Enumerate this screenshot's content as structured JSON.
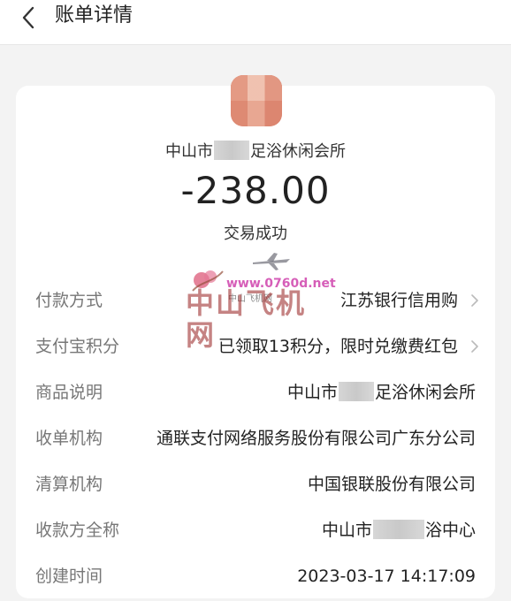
{
  "header": {
    "title": "账单详情"
  },
  "summary": {
    "merchant_prefix": "中山市",
    "merchant_suffix": "足浴休闲会所",
    "amount": "-238.00",
    "status": "交易成功"
  },
  "rows": [
    {
      "label": "付款方式",
      "value": "江苏银行信用购"
    },
    {
      "label": "支付宝积分",
      "value": "已领取13积分，限时兑缴费红包"
    },
    {
      "label": "商品说明",
      "value_prefix": "中山市",
      "value_suffix": "足浴休闲会所"
    },
    {
      "label": "收单机构",
      "value": "通联支付网络服务股份有限公司广东分公司"
    },
    {
      "label": "清算机构",
      "value": "中国银联股份有限公司"
    },
    {
      "label": "收款方全称",
      "value_prefix": "中山市",
      "value_suffix": "浴中心"
    },
    {
      "label": "创建时间",
      "value": "2023-03-17 14:17:09"
    }
  ],
  "watermark": {
    "url": "www.0760d.net",
    "title": "中山飞机网",
    "small": "中山飞机网"
  },
  "colors": {
    "label": "#777777",
    "value": "#222222",
    "background": "#f3f3f3",
    "avatar": "#e18e75"
  }
}
